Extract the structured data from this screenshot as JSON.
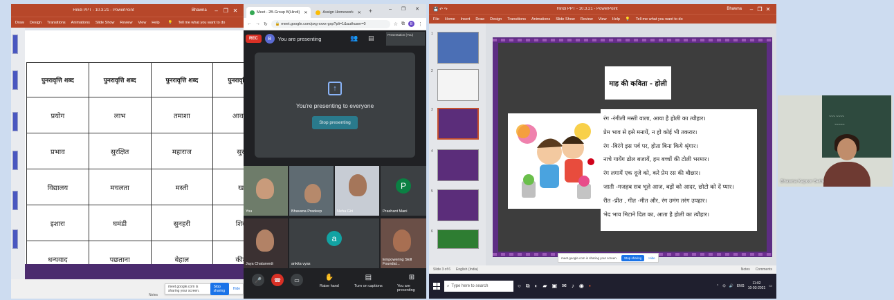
{
  "left_ppt": {
    "title": "Hindi PPT - 10.3.21 - PowerPoint",
    "user": "Bhawna",
    "ribbon": [
      "Draw",
      "Design",
      "Transitions",
      "Animations",
      "Slide Show",
      "Review",
      "View",
      "Help"
    ],
    "tell_me": "Tell me what you want to do",
    "table": {
      "headers": [
        "पुनरावृत्ति शब्द",
        "पुनरावृत्ति शब्द",
        "पुनरावृत्ति शब्द",
        "पुनरावृत्ति शब्द"
      ],
      "rows": [
        [
          "प्रयोग",
          "लाभ",
          "तमाशा",
          "आवश्यक"
        ],
        [
          "प्रभाव",
          "सुरक्षित",
          "महाराज",
          "सुरक्षा"
        ],
        [
          "विद्यालय",
          "मचलता",
          "मस्ती",
          "खत्म"
        ],
        [
          "इशारा",
          "घमंडी",
          "सुनहरी",
          "शिकार"
        ],
        [
          "धन्यवाद",
          "पछताना",
          "बेहाल",
          "कीमती"
        ]
      ]
    },
    "share_bar": {
      "text": "meet.google.com is sharing your screen.",
      "stop": "Stop sharing",
      "hide": "Hide"
    },
    "zoom": "Notes"
  },
  "chrome": {
    "tabs": [
      {
        "label": "Meet - 2B-Group B(Hindi)",
        "fav_color": "#34a853",
        "active": true
      },
      {
        "label": "Assign Homework",
        "fav_color": "#fbbc04",
        "active": false
      }
    ],
    "url": "meet.google.com/pxg-xxxx-gxp?pli=1&authuser=0",
    "profile_initial": "B",
    "rec_label": "REC",
    "presenter_initial": "B",
    "presenting_label": "You are presenting",
    "presentation_thumb_label": "Presentation (You)",
    "panel_text": "You're presenting to everyone",
    "stop_presenting": "Stop presenting",
    "participants": [
      {
        "name": "You"
      },
      {
        "name": "Bhavana Pradeep"
      },
      {
        "name": "Neha Giri"
      },
      {
        "name": "Prashant Mani",
        "initial": "P",
        "color": "#0b8043"
      },
      {
        "name": "Jaya Chaturvedi"
      },
      {
        "name": "ankita vyas",
        "initial": "a",
        "color": "#12a3a3"
      },
      {
        "name": "Empowering Skill Foundat..."
      }
    ],
    "bottom": {
      "raise_hand": "Raise hand",
      "captions": "Turn on captions",
      "you_presenting": "You are presenting"
    }
  },
  "right_ppt": {
    "title": "Hindi PPT - 10.3.21 - PowerPoint",
    "user": "Bhawna",
    "ribbon": [
      "File",
      "Home",
      "Insert",
      "Draw",
      "Design",
      "Transitions",
      "Animations",
      "Slide Show",
      "Review",
      "View",
      "Help"
    ],
    "tell_me": "Tell me what you want to do",
    "thumb_numbers": [
      "1",
      "2",
      "3",
      "4",
      "5",
      "6"
    ],
    "poem_title": "माह की कविता - होली",
    "poem_lines": [
      "रंग -रंगीली मस्ती वाला, आया है होली का त्यौहार।",
      "प्रेम भाव से इसे मनायें, न हो कोई भी तकरार।",
      "रंग -बिरंगे इस पर्व पर, होता बिना किये श्रृंगार।",
      "नाचे गायेंग ढोल बजायें, हम बच्चों की टोली भरमार।",
      "रंग लगायें एक दूजे को, करे प्रेम रस की बौछार।",
      "जाती -मजहब सब भूले आज, बड़ों को आदर, छोटो को दें प्यार।",
      "रीत -प्रीत , गीत -मीत और, रंग उमंग तरंग उपहार।",
      "भेद भाव मिटाने दिल का, आता है होली का त्यौहार।"
    ],
    "status": {
      "slide": "Slide 3 of 6",
      "lang": "English (India)",
      "notes": "Notes",
      "comments": "Comments"
    },
    "share_bar": {
      "text": "meet.google.com is sharing your screen.",
      "stop": "Stop sharing",
      "hide": "Hide"
    },
    "taskbar": {
      "search_placeholder": "Type here to search",
      "lang": "ENG",
      "time": "11:02",
      "date": "10-03-2021"
    }
  },
  "webcam": {
    "name": "Bhawna Kapoor Sethi"
  }
}
